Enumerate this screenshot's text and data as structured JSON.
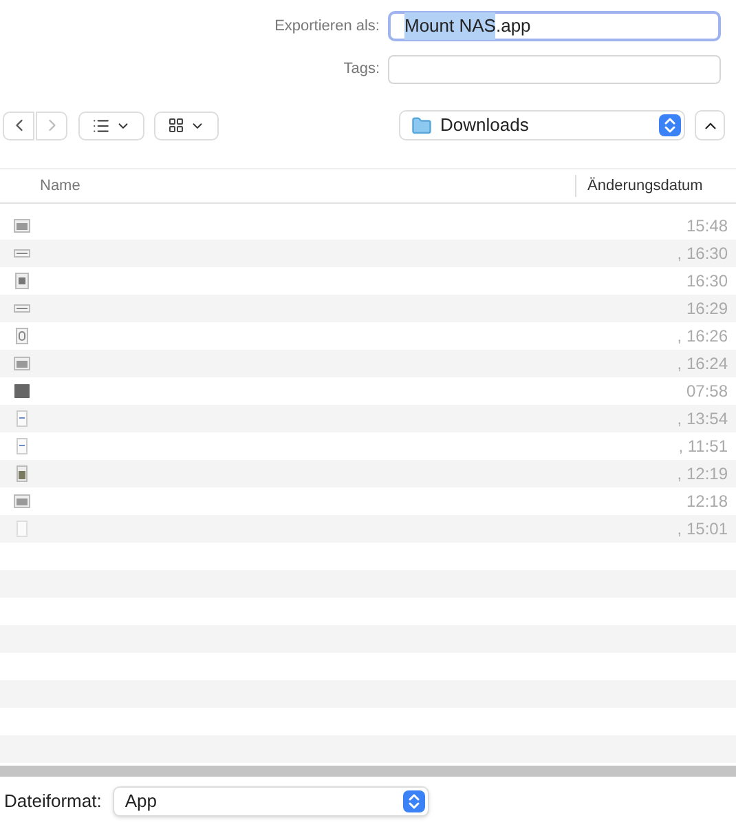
{
  "export_as": {
    "label": "Exportieren als:",
    "selected_text": "Mount NAS",
    "rest_text": ".app",
    "focused": true
  },
  "tags": {
    "label": "Tags:"
  },
  "toolbar": {
    "location": "Downloads"
  },
  "table": {
    "columns": [
      "Name",
      "Änderungsdatum"
    ],
    "rows": [
      {
        "kind": "image",
        "date": "15:48"
      },
      {
        "kind": "strip",
        "date": ", 16:30"
      },
      {
        "kind": "square",
        "date": "16:30"
      },
      {
        "kind": "strip",
        "date": "16:29"
      },
      {
        "kind": "phone",
        "date": ", 16:26"
      },
      {
        "kind": "image",
        "date": ", 16:24"
      },
      {
        "kind": "dark",
        "date": "07:58"
      },
      {
        "kind": "doc",
        "date": ", 13:54"
      },
      {
        "kind": "doc",
        "date": ", 11:51"
      },
      {
        "kind": "tall",
        "date": ", 12:19"
      },
      {
        "kind": "image",
        "date": "12:18"
      },
      {
        "kind": "blank",
        "date": ", 15:01"
      }
    ]
  },
  "format": {
    "label": "Dateiformat:",
    "value": "App"
  }
}
